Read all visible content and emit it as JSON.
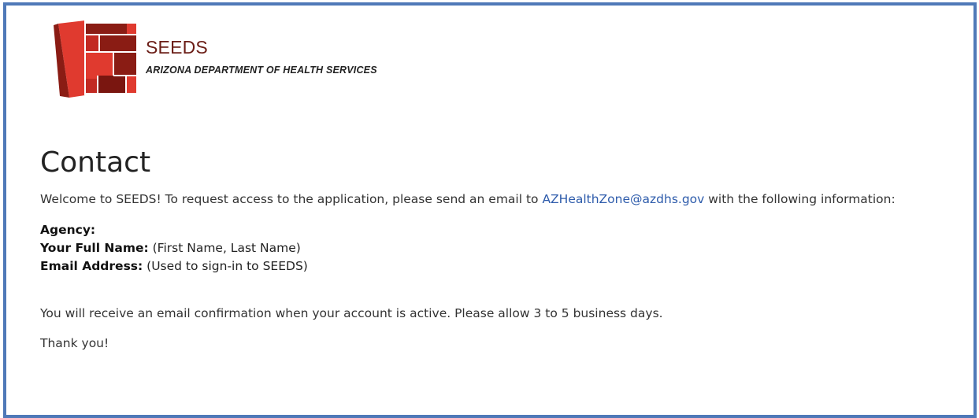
{
  "brand": {
    "name": "SEEDS",
    "department": "ARIZONA DEPARTMENT OF HEALTH SERVICES",
    "logo_icon": "seeds-logo-icon",
    "colors": {
      "logo_red": "#e03a2f",
      "logo_dark": "#8a1c14",
      "brand_text": "#6b1d16",
      "frame_border": "#4f79b8",
      "link": "#2d5bab"
    }
  },
  "page": {
    "title": "Contact",
    "intro_before": "Welcome to SEEDS! To request access to the application, please send an email to ",
    "email_link": "AZHealthZone@azdhs.gov",
    "intro_after": " with the following information:",
    "fields": [
      {
        "label": "Agency:",
        "hint": ""
      },
      {
        "label": "Your Full Name:",
        "hint": " (First Name, Last Name)"
      },
      {
        "label": "Email Address:",
        "hint": " (Used to sign-in to SEEDS)"
      }
    ],
    "confirmation": "You will receive an email confirmation when your account is active. Please allow 3 to 5 business days.",
    "thanks": "Thank you!"
  }
}
